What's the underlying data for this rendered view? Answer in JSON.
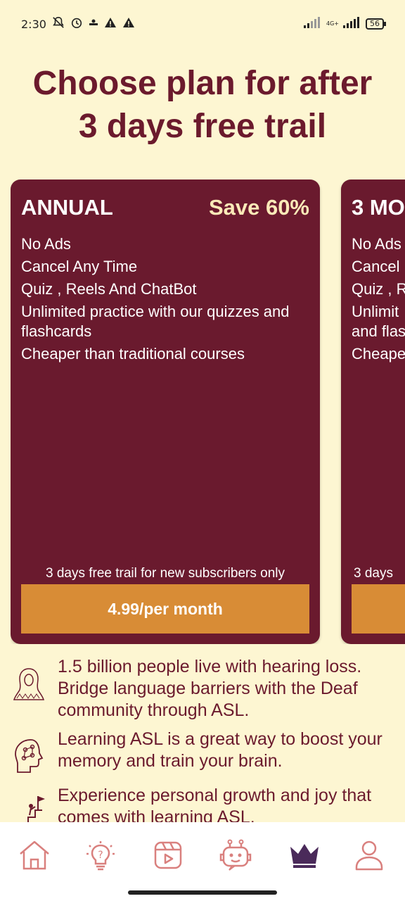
{
  "status_bar": {
    "time": "2:30",
    "network": "4G+",
    "battery": "56",
    "icons": [
      "bell-off-icon",
      "alarm-icon",
      "notification-icon",
      "warning-icon",
      "warning-icon"
    ]
  },
  "headline": {
    "line1": "Choose plan for after",
    "line2": "3 days free trail"
  },
  "plans": [
    {
      "name": "ANNUAL",
      "save": "Save 60%",
      "features": [
        "No Ads",
        "Cancel Any Time",
        "Quiz , Reels And ChatBot",
        "Unlimited practice with our quizzes and flashcards",
        "Cheaper than traditional courses"
      ],
      "trial_note": "3 days free trail for new subscribers only",
      "price": "4.99/per month"
    },
    {
      "name": "3 MO",
      "features": [
        "No Ads",
        "Cancel",
        "Quiz , R",
        "Unlimit",
        "and flas",
        "Cheape"
      ],
      "trial_note": "3 days"
    }
  ],
  "benefits": [
    {
      "icon": "person-hair-icon",
      "text": "1.5 billion people live with hearing loss. Bridge language barriers with the Deaf community through ASL."
    },
    {
      "icon": "brain-head-icon",
      "text": "Learning ASL is a great way to boost your memory and train your brain."
    },
    {
      "icon": "growth-stairs-icon",
      "text": "Experience personal growth and joy that comes with learning ASL."
    }
  ],
  "nav": {
    "items": [
      "home-icon",
      "quiz-bulb-icon",
      "reels-icon",
      "chatbot-icon",
      "premium-crown-icon",
      "profile-icon"
    ],
    "active": "premium-crown-icon"
  },
  "colors": {
    "background": "#fdf6d2",
    "card": "#6a1a2e",
    "accent": "#d88c36",
    "save_text": "#fbeab8",
    "nav_icon": "#d9807e",
    "nav_active": "#4a2a5a"
  }
}
